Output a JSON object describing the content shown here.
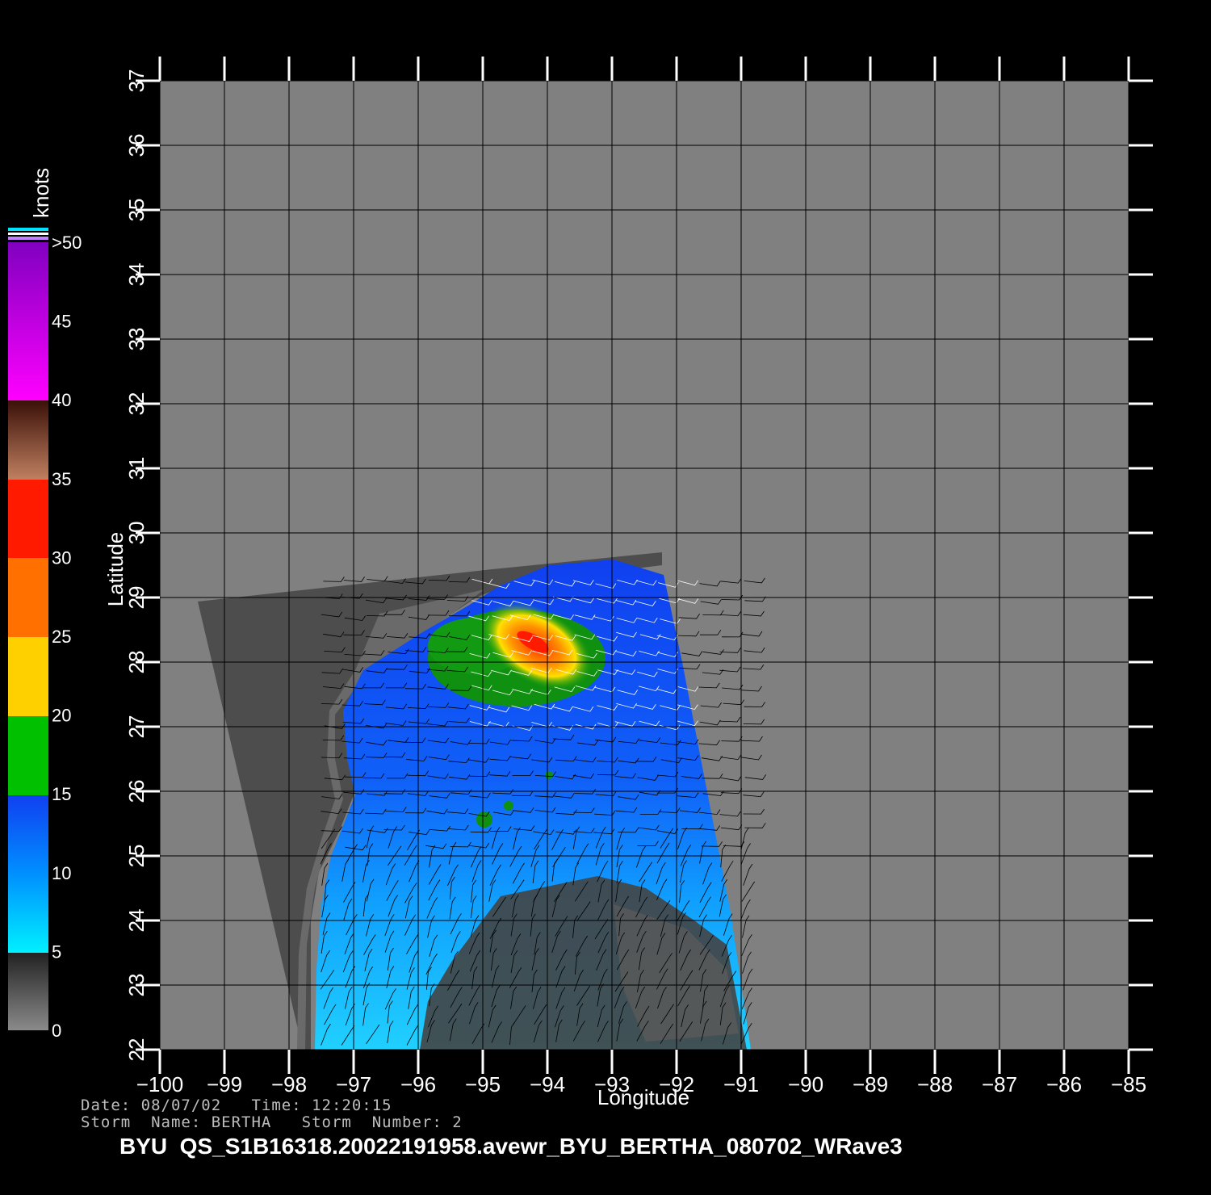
{
  "axes": {
    "x_label": "Longitude",
    "y_label": "Latitude",
    "x_ticks": [
      "-100",
      "-99",
      "-98",
      "-97",
      "-96",
      "-95",
      "-94",
      "-93",
      "-92",
      "-91",
      "-90",
      "-89",
      "-88",
      "-87",
      "-86",
      "-85"
    ],
    "y_ticks": [
      "22",
      "23",
      "24",
      "25",
      "26",
      "27",
      "28",
      "29",
      "30",
      "31",
      "32",
      "33",
      "34",
      "35",
      "36",
      "37"
    ],
    "xlim": [
      -100,
      -85
    ],
    "ylim": [
      22,
      37
    ]
  },
  "colorbar": {
    "unit": "knots",
    "labels": [
      "0",
      "5",
      "10",
      "15",
      "20",
      "25",
      "30",
      "35",
      "40",
      "45",
      ">50"
    ],
    "colors": [
      "#777777",
      "#00f0ff",
      "#0070ff",
      "#1030f0",
      "#00c000",
      "#ffe000",
      "#ff8000",
      "#ff2000",
      "#703018",
      "#ff00ff",
      "#9000e0",
      "#7000c0"
    ]
  },
  "footer": {
    "date_line": "Date: 08/07/02   Time: 12:20:15",
    "storm_line": "Storm  Name: BERTHA   Storm  Number: 2",
    "product": "BYU  QS_S1B16318.20022191958.avewr_BYU_BERTHA_080702_WRave3"
  },
  "map": {
    "background_color": "#808080",
    "land_mask_color": "#4d4d4d",
    "storm_center": {
      "lon": -94.2,
      "lat": 28.3,
      "max_speed_knots": 35
    }
  }
}
